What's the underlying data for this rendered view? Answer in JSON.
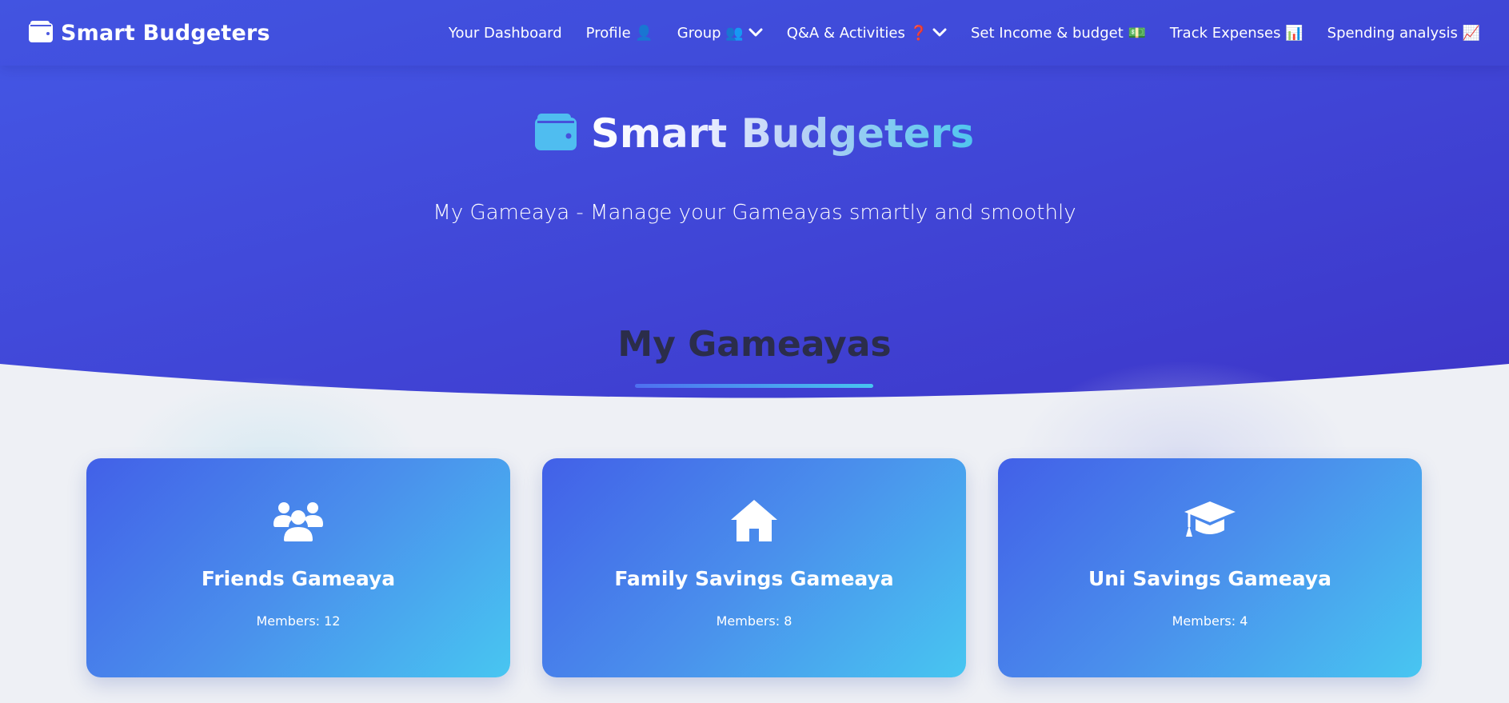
{
  "brand": {
    "name": "Smart Budgeters",
    "icon": "wallet-icon"
  },
  "nav": {
    "items": [
      {
        "label": "Your Dashboard",
        "dropdown": false
      },
      {
        "label": "Profile 👤",
        "dropdown": false
      },
      {
        "label": "Group 👥",
        "dropdown": true
      },
      {
        "label": "Q&A & Activities ❓",
        "dropdown": true
      },
      {
        "label": "Set Income & budget 💵",
        "dropdown": false
      },
      {
        "label": "Track Expenses 📊",
        "dropdown": false
      },
      {
        "label": "Spending analysis 📈",
        "dropdown": false
      }
    ]
  },
  "hero": {
    "title": "Smart Budgeters",
    "subtitle": "My Gameaya - Manage your Gameayas smartly and smoothly"
  },
  "section": {
    "title": "My Gameayas"
  },
  "cards": [
    {
      "icon": "users-icon",
      "title": "Friends Gameaya",
      "members": "Members: 12"
    },
    {
      "icon": "home-icon",
      "title": "Family Savings Gameaya",
      "members": "Members: 8"
    },
    {
      "icon": "graduation-cap-icon",
      "title": "Uni Savings Gameaya",
      "members": "Members: 4"
    }
  ],
  "colors": {
    "hero_start": "#4458e6",
    "hero_end": "#3d36c9",
    "page_bg": "#eef0f5",
    "card_start": "#4260e8",
    "card_end": "#48c6f1",
    "accent": "#47c5f0",
    "heading": "#2b2d4a"
  }
}
